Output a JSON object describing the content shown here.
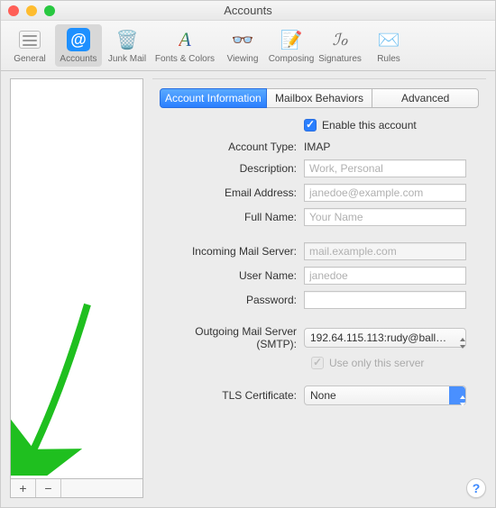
{
  "window": {
    "title": "Accounts"
  },
  "toolbar": {
    "items": [
      {
        "label": "General"
      },
      {
        "label": "Accounts"
      },
      {
        "label": "Junk Mail"
      },
      {
        "label": "Fonts & Colors"
      },
      {
        "label": "Viewing"
      },
      {
        "label": "Composing"
      },
      {
        "label": "Signatures"
      },
      {
        "label": "Rules"
      }
    ]
  },
  "tabs": {
    "items": [
      {
        "label": "Account Information"
      },
      {
        "label": "Mailbox Behaviors"
      },
      {
        "label": "Advanced"
      }
    ]
  },
  "form": {
    "enable_label": "Enable this account",
    "account_type_label": "Account Type:",
    "account_type_value": "IMAP",
    "description_label": "Description:",
    "description_placeholder": "Work, Personal",
    "email_label": "Email Address:",
    "email_placeholder": "janedoe@example.com",
    "fullname_label": "Full Name:",
    "fullname_placeholder": "Your Name",
    "incoming_label": "Incoming Mail Server:",
    "incoming_placeholder": "mail.example.com",
    "username_label": "User Name:",
    "username_placeholder": "janedoe",
    "password_label": "Password:",
    "smtp_label": "Outgoing Mail Server (SMTP):",
    "smtp_value": "192.64.115.113:rudy@ballistic",
    "use_only_label": "Use only this server",
    "tls_label": "TLS Certificate:",
    "tls_value": "None"
  },
  "sidebar_buttons": {
    "add": "+",
    "remove": "−"
  },
  "help": "?"
}
